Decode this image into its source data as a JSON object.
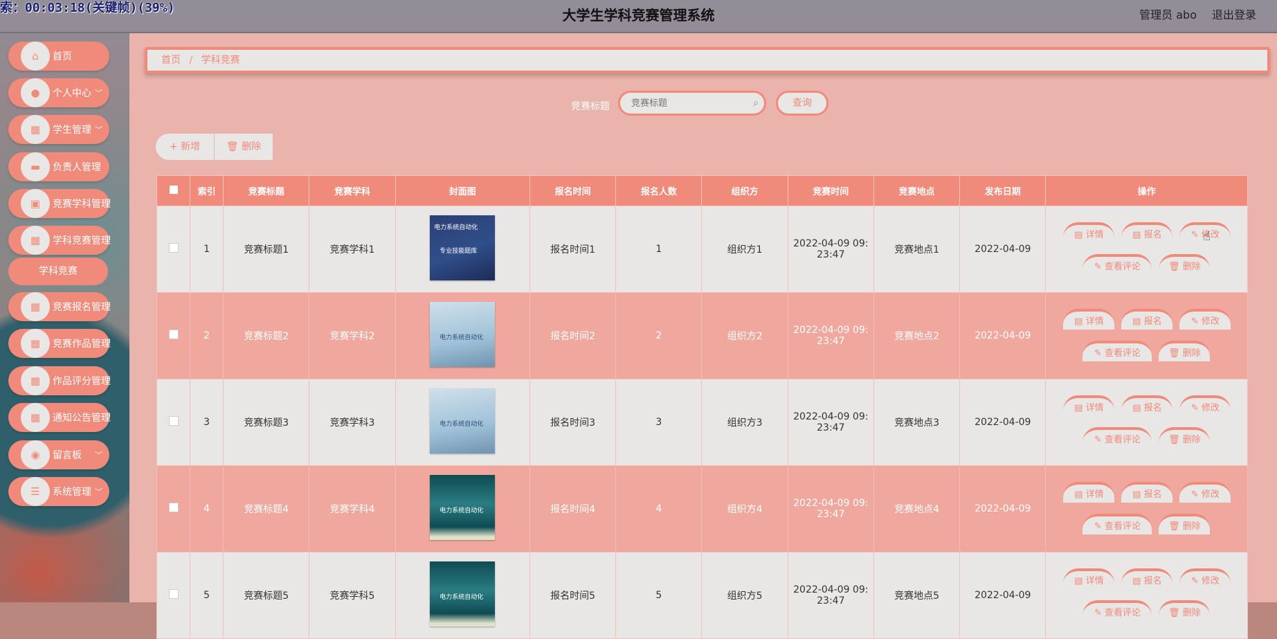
{
  "overlay": {
    "recording_text": "索：00:03:18(关键帧)(39%)"
  },
  "header": {
    "title": "大学生学科竞赛管理系统",
    "admin_label": "管理员 abo",
    "logout_label": "退出登录"
  },
  "sidebar": {
    "items": [
      {
        "label": "首页",
        "icon": "home-icon",
        "caret": false
      },
      {
        "label": "个人中心",
        "icon": "user-icon",
        "caret": true
      },
      {
        "label": "学生管理",
        "icon": "grid-icon",
        "caret": true
      },
      {
        "label": "负责人管理",
        "icon": "ticket-icon",
        "caret": false
      },
      {
        "label": "竞赛学科管理",
        "icon": "clipboard-icon",
        "caret": false
      },
      {
        "label": "学科竞赛管理",
        "icon": "grid-icon",
        "caret": false
      },
      {
        "label": "竞赛报名管理",
        "icon": "grid-icon",
        "caret": false
      },
      {
        "label": "竞赛作品管理",
        "icon": "grid-icon",
        "caret": false
      },
      {
        "label": "作品评分管理",
        "icon": "grid-icon",
        "caret": false
      },
      {
        "label": "通知公告管理",
        "icon": "grid-icon",
        "caret": false
      },
      {
        "label": "留言板",
        "icon": "location-icon",
        "caret": true
      },
      {
        "label": "系统管理",
        "icon": "menu-icon",
        "caret": true
      }
    ],
    "sub_item": {
      "label": "学科竞赛"
    }
  },
  "breadcrumb": {
    "home": "首页",
    "separator": "/",
    "current": "学科竞赛"
  },
  "search": {
    "label": "竞赛标题",
    "placeholder": "竞赛标题",
    "value": "",
    "button": "查询"
  },
  "toolbar": {
    "add": "新增",
    "delete": "删除"
  },
  "table": {
    "headers": [
      "索引",
      "竞赛标题",
      "竞赛学科",
      "封面图",
      "报名时间",
      "报名人数",
      "组织方",
      "竞赛时间",
      "竞赛地点",
      "发布日期",
      "操作"
    ],
    "rows": [
      {
        "index": "1",
        "title": "竞赛标题1",
        "subject": "竞赛学科1",
        "reg_time": "报名时间1",
        "count": "1",
        "org": "组织方1",
        "time1": "2022-04-09 09:",
        "time2": "23:47",
        "place": "竞赛地点1",
        "date": "2022-04-09"
      },
      {
        "index": "2",
        "title": "竞赛标题2",
        "subject": "竞赛学科2",
        "reg_time": "报名时间2",
        "count": "2",
        "org": "组织方2",
        "time1": "2022-04-09 09:",
        "time2": "23:47",
        "place": "竞赛地点2",
        "date": "2022-04-09"
      },
      {
        "index": "3",
        "title": "竞赛标题3",
        "subject": "竞赛学科3",
        "reg_time": "报名时间3",
        "count": "3",
        "org": "组织方3",
        "time1": "2022-04-09 09:",
        "time2": "23:47",
        "place": "竞赛地点3",
        "date": "2022-04-09"
      },
      {
        "index": "4",
        "title": "竞赛标题4",
        "subject": "竞赛学科4",
        "reg_time": "报名时间4",
        "count": "4",
        "org": "组织方4",
        "time1": "2022-04-09 09:",
        "time2": "23:47",
        "place": "竞赛地点4",
        "date": "2022-04-09"
      },
      {
        "index": "5",
        "title": "竞赛标题5",
        "subject": "竞赛学科5",
        "reg_time": "报名时间5",
        "count": "5",
        "org": "组织方5",
        "time1": "2022-04-09 09:",
        "time2": "23:47",
        "place": "竞赛地点5",
        "date": "2022-04-09"
      }
    ],
    "covers": [
      {
        "line1": "电力系统自动化",
        "line2": "专业技能题库"
      },
      {
        "line1": "",
        "line2": "电力系统自动化"
      },
      {
        "line1": "",
        "line2": "电力系统自动化"
      },
      {
        "line1": "",
        "line2": "电力系统自动化"
      },
      {
        "line1": "",
        "line2": "电力系统自动化"
      }
    ],
    "actions": {
      "detail": "详情",
      "signup": "报名",
      "edit": "修改",
      "comments": "查看评论",
      "delete": "删除"
    }
  },
  "colors": {
    "accent": "#f08a7a",
    "light": "#e9e6e6",
    "pink_row": "#f0a89e"
  }
}
